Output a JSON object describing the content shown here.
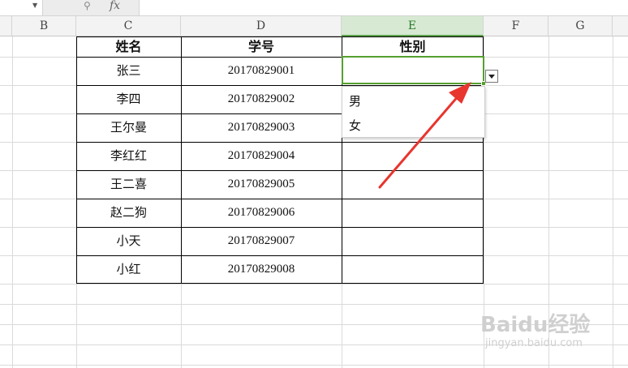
{
  "formula_bar": {
    "namebox_dropdown_icon": "chevron-down-icon",
    "zoom_icon": "magnifier-icon",
    "fx_label": "fx",
    "value": ""
  },
  "columns": {
    "b": "B",
    "c": "C",
    "d": "D",
    "e": "E",
    "f": "F",
    "g": "G",
    "selected": "E"
  },
  "table": {
    "headers": {
      "name": "姓名",
      "id": "学号",
      "gender": "性别"
    },
    "rows": [
      {
        "name": "张三",
        "id": "20170829001",
        "gender": ""
      },
      {
        "name": "李四",
        "id": "20170829002",
        "gender": ""
      },
      {
        "name": "王尔曼",
        "id": "20170829003",
        "gender": ""
      },
      {
        "name": "李红红",
        "id": "20170829004",
        "gender": ""
      },
      {
        "name": "王二喜",
        "id": "20170829005",
        "gender": ""
      },
      {
        "name": "赵二狗",
        "id": "20170829006",
        "gender": ""
      },
      {
        "name": "小天",
        "id": "20170829007",
        "gender": ""
      },
      {
        "name": "小红",
        "id": "20170829008",
        "gender": ""
      }
    ]
  },
  "dropdown": {
    "options": [
      "男",
      "女"
    ]
  },
  "annotation": {
    "arrow_color": "#e8352e"
  },
  "colors": {
    "selection": "#55a02f",
    "selected_header_bg": "#d7e9d2"
  },
  "watermark": {
    "logo": "Baidu经验",
    "sub": "jingyan.baidu.com"
  }
}
